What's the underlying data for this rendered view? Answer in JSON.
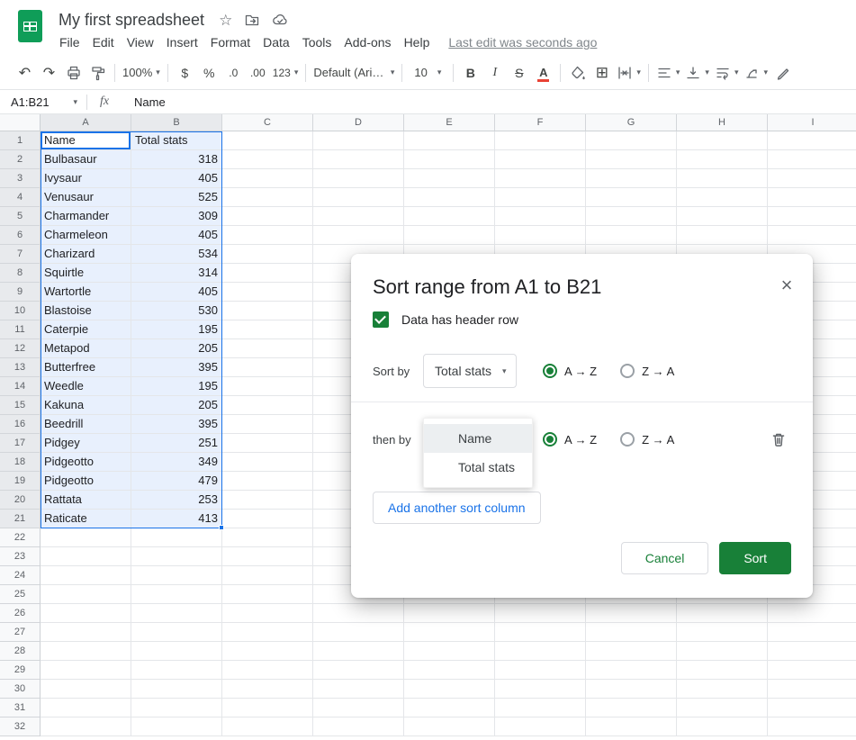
{
  "header": {
    "title": "My first spreadsheet",
    "menus": [
      "File",
      "Edit",
      "View",
      "Insert",
      "Format",
      "Data",
      "Tools",
      "Add-ons",
      "Help"
    ],
    "last_edit": "Last edit was seconds ago"
  },
  "toolbar": {
    "zoom": "100%",
    "currency": "$",
    "percent": "%",
    "decrease_decimal": ".0",
    "increase_decimal": ".00",
    "more_formats": "123",
    "font_name": "Default (Ari…",
    "font_size": "10",
    "bold": "B",
    "italic": "I",
    "strikethrough": "S",
    "text_color": "A"
  },
  "formula_bar": {
    "name_box": "A1:B21",
    "fx": "fx",
    "content": "Name"
  },
  "grid": {
    "columns": [
      "A",
      "B",
      "C",
      "D",
      "E",
      "F",
      "G",
      "H",
      "I"
    ],
    "rows_visible": 32,
    "selection": {
      "range": "A1:B21",
      "active_cell": "A1",
      "selected_rows": 21,
      "selected_cols": 2
    },
    "table": {
      "headers": [
        "Name",
        "Total stats"
      ],
      "rows": [
        [
          "Bulbasaur",
          "318"
        ],
        [
          "Ivysaur",
          "405"
        ],
        [
          "Venusaur",
          "525"
        ],
        [
          "Charmander",
          "309"
        ],
        [
          "Charmeleon",
          "405"
        ],
        [
          "Charizard",
          "534"
        ],
        [
          "Squirtle",
          "314"
        ],
        [
          "Wartortle",
          "405"
        ],
        [
          "Blastoise",
          "530"
        ],
        [
          "Caterpie",
          "195"
        ],
        [
          "Metapod",
          "205"
        ],
        [
          "Butterfree",
          "395"
        ],
        [
          "Weedle",
          "195"
        ],
        [
          "Kakuna",
          "205"
        ],
        [
          "Beedrill",
          "395"
        ],
        [
          "Pidgey",
          "251"
        ],
        [
          "Pidgeotto",
          "349"
        ],
        [
          "Pidgeotto",
          "479"
        ],
        [
          "Rattata",
          "253"
        ],
        [
          "Raticate",
          "413"
        ]
      ]
    }
  },
  "dialog": {
    "title": "Sort range from A1 to B21",
    "header_row_checkbox": "Data has header row",
    "sort_by_label": "Sort by",
    "then_by_label": "then by",
    "sort_by_value": "Total stats",
    "asc": "A → Z",
    "desc": "Z → A",
    "menu_options": [
      "Name",
      "Total stats"
    ],
    "add_column_button": "Add another sort column",
    "cancel_button": "Cancel",
    "sort_button": "Sort"
  },
  "icons": {
    "undo": "↶",
    "redo": "↷",
    "caret": "▾",
    "star": "☆",
    "close": "×",
    "borders": "⊞"
  },
  "colors": {
    "accent_green": "#188038",
    "logo_green": "#0f9d58",
    "accent_blue": "#1a73e8",
    "selection_fill": "#e8f0fd"
  }
}
